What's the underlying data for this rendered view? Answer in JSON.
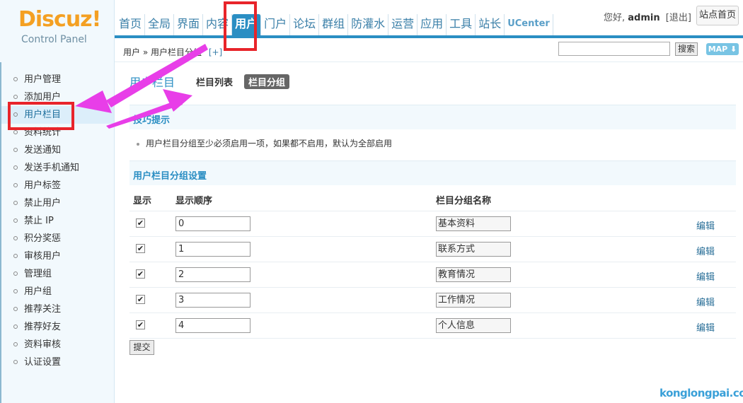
{
  "header": {
    "logo": "Discuz!",
    "logo_sub": "Control Panel",
    "nav": [
      "首页",
      "全局",
      "界面",
      "内容",
      "用户",
      "门户",
      "论坛",
      "群组",
      "防灌水",
      "运营",
      "应用",
      "工具",
      "站长",
      "UCenter"
    ],
    "active_nav": "用户",
    "greeting": "您好,",
    "username": "admin",
    "logout": "[退出]",
    "site_home": "站点首页"
  },
  "crumb": {
    "text": "用户 » 用户栏目分组",
    "plus": "[+]",
    "search_button": "搜索",
    "map_button": "MAP ⬇"
  },
  "sidebar": {
    "items": [
      "用户管理",
      "添加用户",
      "用户栏目",
      "资料统计",
      "发送通知",
      "发送手机通知",
      "用户标签",
      "禁止用户",
      "禁止 IP",
      "积分奖惩",
      "审核用户",
      "管理组",
      "用户组",
      "推荐关注",
      "推荐好友",
      "资料审核",
      "认证设置"
    ],
    "active_item": "用户栏目"
  },
  "main": {
    "title": "用户栏目",
    "tabs": [
      "栏目列表",
      "栏目分组"
    ],
    "current_tab": "栏目分组",
    "tip_title": "技巧提示",
    "tip_text": "用户栏目分组至少必须启用一项，如果都不启用，默认为全部启用",
    "section_title": "用户栏目分组设置",
    "columns": {
      "show": "显示",
      "order": "显示顺序",
      "name": "栏目分组名称"
    },
    "rows": [
      {
        "checked": true,
        "order": "0",
        "name": "基本资料",
        "edit": "编辑"
      },
      {
        "checked": true,
        "order": "1",
        "name": "联系方式",
        "edit": "编辑"
      },
      {
        "checked": true,
        "order": "2",
        "name": "教育情况",
        "edit": "编辑"
      },
      {
        "checked": true,
        "order": "3",
        "name": "工作情况",
        "edit": "编辑"
      },
      {
        "checked": true,
        "order": "4",
        "name": "个人信息",
        "edit": "编辑"
      }
    ],
    "submit": "提交"
  },
  "watermark": "konglongpai.com",
  "colors": {
    "accent": "#2a8ec3",
    "logo": "#f4a022",
    "annotation": "#e8242a",
    "arrow": "#e83ee8"
  }
}
